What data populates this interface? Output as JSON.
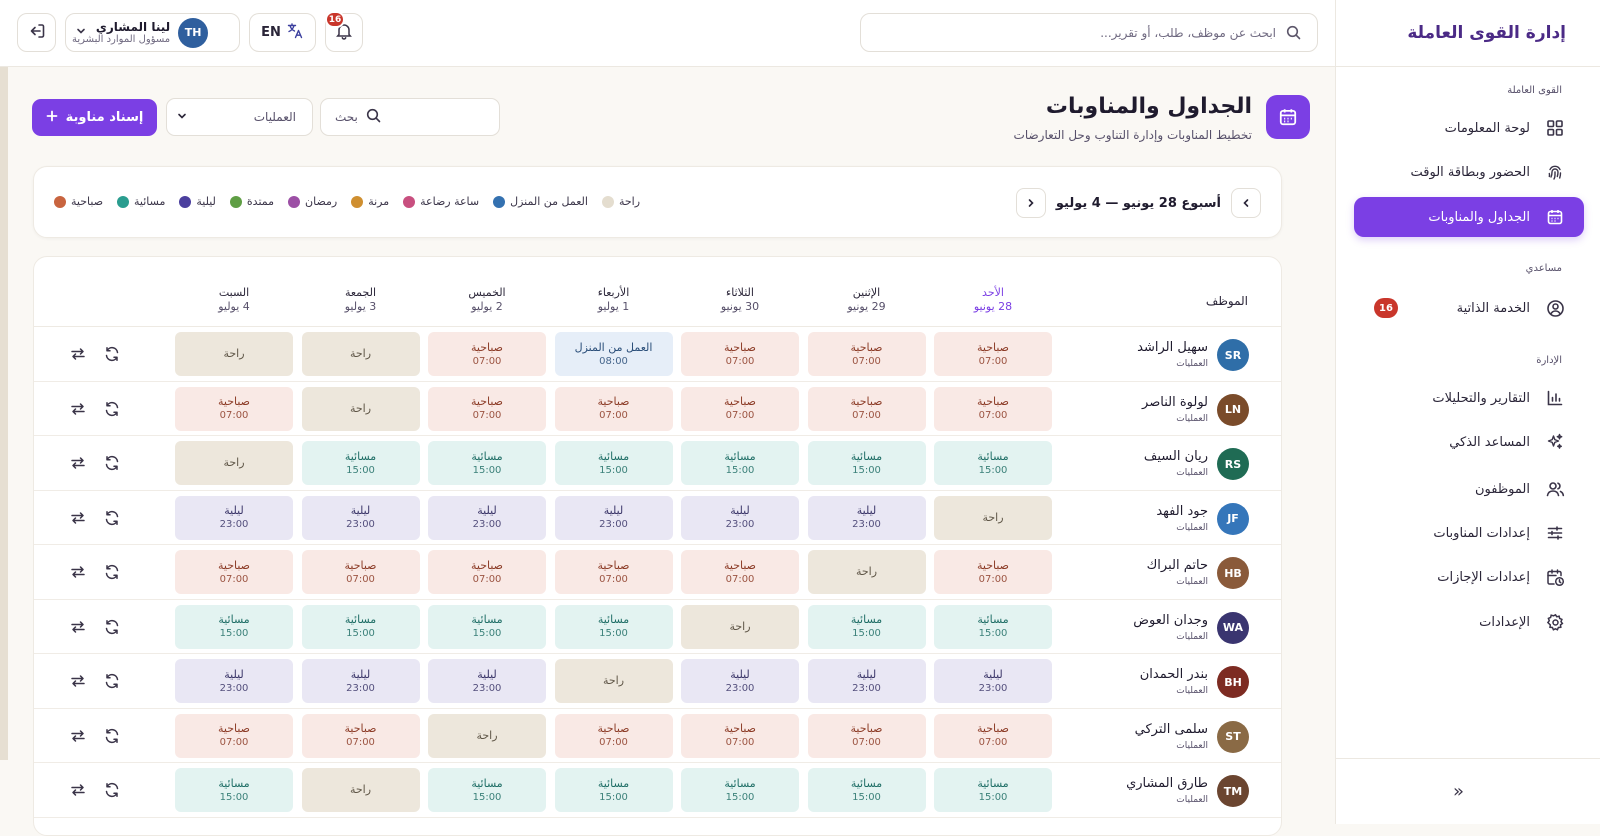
{
  "app": {
    "brand": "إدارة القوى العاملة"
  },
  "topbar": {
    "search_placeholder": "ابحث عن موظف، طلب، أو تقرير...",
    "user_name": "لينا المشاري",
    "user_role": "مسؤول الموارد البشرية",
    "user_initials": "TH",
    "lang": "EN",
    "notifications": "16"
  },
  "sidebar": {
    "sections": {
      "workforce": "القوى العاملة",
      "assistant": "مساعدي",
      "admin": "الإدارة"
    },
    "items": [
      {
        "label": "لوحة المعلومات",
        "icon": "dashboard-icon"
      },
      {
        "label": "الحضور وبطاقة الوقت",
        "icon": "fingerprint-icon"
      },
      {
        "label": "الجداول والمناوبات",
        "icon": "calendar-icon",
        "active": true
      },
      {
        "label": "الخدمة الذاتية",
        "icon": "user-circle-icon",
        "badge": "16"
      },
      {
        "label": "التقارير والتحليلات",
        "icon": "bar-chart-icon"
      },
      {
        "label": "المساعد الذكي",
        "icon": "sparkles-icon"
      },
      {
        "label": "الموظفون",
        "icon": "users-icon"
      },
      {
        "label": "إعدادات المناوبات",
        "icon": "sliders-icon"
      },
      {
        "label": "إعدادات الإجازات",
        "icon": "calendar-clock-icon"
      },
      {
        "label": "الإعدادات",
        "icon": "gear-icon"
      }
    ],
    "collapse": "«"
  },
  "page": {
    "title": "الجداول والمناوبات",
    "subtitle": "تخطيط المناوبات وإدارة التناوب وحل التعارضات",
    "assign_label": "إسناد مناوبة",
    "ops_select": "العمليات",
    "search_placeholder": "بحث"
  },
  "week": {
    "label": "أسبوع 28 يونيو — 4 يوليو"
  },
  "legend": [
    {
      "label": "صباحية",
      "color": "#c8643f"
    },
    {
      "label": "مسائية",
      "color": "#2a9d8f"
    },
    {
      "label": "ليلية",
      "color": "#4b3f9e"
    },
    {
      "label": "ممتدة",
      "color": "#5f9e44"
    },
    {
      "label": "رمضان",
      "color": "#9c4fa5"
    },
    {
      "label": "مرنة",
      "color": "#cf8f30"
    },
    {
      "label": "ساعة رضاعة",
      "color": "#c84f7f"
    },
    {
      "label": "العمل من المنزل",
      "color": "#3471b0"
    },
    {
      "label": "راحة",
      "color": "#e4ddcf"
    }
  ],
  "grid": {
    "employee_header": "الموظف",
    "days": [
      {
        "name": "الأحد",
        "date": "28 يونيو",
        "today": true
      },
      {
        "name": "الإثنين",
        "date": "29 يونيو"
      },
      {
        "name": "الثلاثاء",
        "date": "30 يونيو"
      },
      {
        "name": "الأربعاء",
        "date": "1 يوليو"
      },
      {
        "name": "الخميس",
        "date": "2 يوليو"
      },
      {
        "name": "الجمعة",
        "date": "3 يوليو"
      },
      {
        "name": "السبت",
        "date": "4 يوليو"
      }
    ],
    "shift_types": {
      "morning": {
        "label": "صباحية",
        "time": "07:00"
      },
      "evening": {
        "label": "مسائية",
        "time": "15:00"
      },
      "night": {
        "label": "ليلية",
        "time": "23:00"
      },
      "rest": {
        "label": "راحة",
        "time": ""
      },
      "wfh": {
        "label": "العمل من المنزل",
        "time": "08:00"
      }
    },
    "employees": [
      {
        "name": "سهيل الراشد",
        "dept": "العمليات",
        "initials": "SR",
        "color": "#2f6ea8",
        "shifts": [
          "morning",
          "morning",
          "morning",
          "wfh",
          "morning",
          "rest",
          "rest"
        ]
      },
      {
        "name": "لولوة الناصر",
        "dept": "العمليات",
        "initials": "LN",
        "color": "#7a4b2a",
        "shifts": [
          "morning",
          "morning",
          "morning",
          "morning",
          "morning",
          "rest",
          "morning"
        ]
      },
      {
        "name": "ريان السيف",
        "dept": "العمليات",
        "initials": "RS",
        "color": "#1f6b54",
        "shifts": [
          "evening",
          "evening",
          "evening",
          "evening",
          "evening",
          "evening",
          "rest"
        ]
      },
      {
        "name": "جود الفهد",
        "dept": "العمليات",
        "initials": "JF",
        "color": "#3576ba",
        "shifts": [
          "rest",
          "night",
          "night",
          "night",
          "night",
          "night",
          "night"
        ]
      },
      {
        "name": "حاتم البراك",
        "dept": "العمليات",
        "initials": "HB",
        "color": "#8a5a3a",
        "shifts": [
          "morning",
          "rest",
          "morning",
          "morning",
          "morning",
          "morning",
          "morning"
        ]
      },
      {
        "name": "وجدان العوض",
        "dept": "العمليات",
        "initials": "WA",
        "color": "#3a3570",
        "shifts": [
          "evening",
          "evening",
          "rest",
          "evening",
          "evening",
          "evening",
          "evening"
        ]
      },
      {
        "name": "بندر الحمدان",
        "dept": "العمليات",
        "initials": "BH",
        "color": "#7d2b22",
        "shifts": [
          "night",
          "night",
          "night",
          "rest",
          "night",
          "night",
          "night"
        ]
      },
      {
        "name": "سلمى التركي",
        "dept": "العمليات",
        "initials": "ST",
        "color": "#8a6a45",
        "shifts": [
          "morning",
          "morning",
          "morning",
          "morning",
          "rest",
          "morning",
          "morning"
        ]
      },
      {
        "name": "طارق المشاري",
        "dept": "العمليات",
        "initials": "TM",
        "color": "#6b4530",
        "shifts": [
          "evening",
          "evening",
          "evening",
          "evening",
          "evening",
          "rest",
          "evening"
        ]
      }
    ]
  }
}
